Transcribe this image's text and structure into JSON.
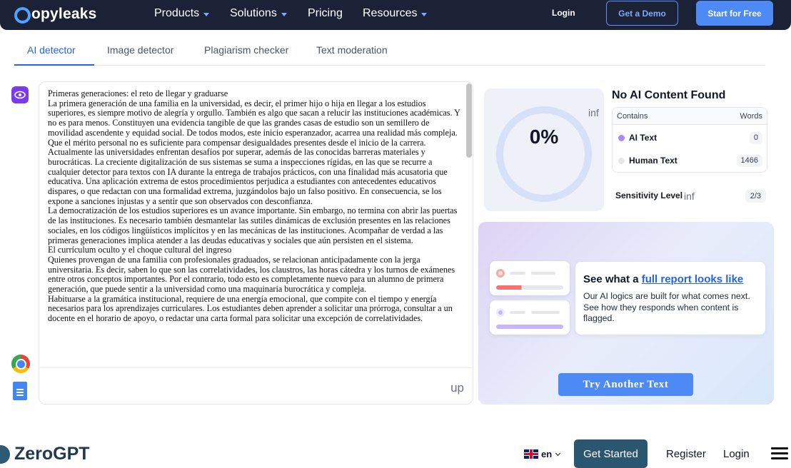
{
  "nav": {
    "brand": "Copyleaks",
    "brand_rest": "opyleaks",
    "items": [
      {
        "label": "Products",
        "has_caret": true
      },
      {
        "label": "Solutions",
        "has_caret": true
      },
      {
        "label": "Pricing",
        "has_caret": false
      },
      {
        "label": "Resources",
        "has_caret": true
      }
    ],
    "login": "Login",
    "demo": "Get a Demo",
    "free": "Start for Free",
    "accent": "#4d8af5"
  },
  "tabs": [
    {
      "label": "AI detector",
      "active": true
    },
    {
      "label": "Image detector",
      "active": false
    },
    {
      "label": "Plagiarism checker",
      "active": false
    },
    {
      "label": "Text moderation",
      "active": false
    }
  ],
  "editor": {
    "paragraphs": [
      "Primeras generaciones: el reto de llegar y graduarse",
      "La primera generación de una familia en la universidad, es decir, el primer hijo o hija en llegar a los estudios superiores, es siempre motivo de alegría y orgullo. También es algo que sacan a relucir las instituciones académicas. Y no es para menos. Constituyen una evidencia tangible de que las grandes casas de estudio son un semillero de movilidad ascendente y equidad social. De todos modos, este inicio esperanzador, acarrea una realidad más compleja. Que el mérito personal no es suficiente para compensar desigualdades presentes desde el inicio de la carrera.",
      "Actualmente las universidades enfrentan desafíos por superar, además de las conocidas barreras materiales y burocráticas. La creciente digitalización de sus sistemas se suma a inspecciones rígidas, en las que se recurre a cualquier detector para textos con IA durante la entrega de trabajos prácticos, con una finalidad más acusatoria que educativa. Una aplicación extrema de estos procedimientos perjudica a estudiantes con antecedentes educativos dispares, o que redactan con una formalidad extrema, juzgándolos bajo un falso positivo. En consecuencia, se los expone a sanciones injustas y a sentir que son observados con desconfianza.",
      "La democratización de los estudios superiores es un avance importante. Sin embargo, no termina con abrir las puertas de las instituciones. Es necesario también desmantelar las sutiles dinámicas de exclusión presentes en las relaciones sociales, en los códigos lingüísticos implícitos y en las mecánicas de las instituciones. Acompañar de verdad a las primeras generaciones implica atender a las deudas educativas y sociales que aún persisten en el sistema.",
      "El currículum oculto y el choque cultural del ingreso",
      "Quienes provengan de una familia con profesionales graduados, se relacionan anticipadamente con la jerga universitaria. Es decir, saben lo que son las correlatividades, los claustros, las horas cátedra y los turnos de exámenes entre otros conceptos importantes. Por el contrario, todo esto es completamente nuevo para un alumno de primera generación, que puede sentir a la universidad como una maquinaria burocrática y compleja.",
      "Habituarse a la gramática institucional, requiere de una energía emocional, que compite con el tiempo y energía necesarios para los aprendizajes curriculares. Los estudiantes deben aprender a solicitar una prórroga, consultar a un docente en el horario de apoyo, o redactar una carta formal para solicitar una excepción de correlatividades."
    ],
    "upload_label": "up",
    "scroll_fraction": 0.26
  },
  "result": {
    "percent_label": "0%",
    "percent": 0,
    "gauge_inf": "inf",
    "title": "No AI Content Found",
    "col_contains": "Contains",
    "col_words": "Words",
    "rows": [
      {
        "label": "AI Text",
        "count": "0",
        "color": "#a78bfa"
      },
      {
        "label": "Human Text",
        "count": "1466",
        "color": "#e5e7eb"
      }
    ],
    "sensitivity_label": "Sensitivity Level",
    "sensitivity_inf": "inf",
    "sensitivity_value": "2/3"
  },
  "promo": {
    "title_prefix": "See what a",
    "title_link": "full report looks like",
    "description": "Our AI logics are built for what comes next. See how they responds when content is flagged.",
    "try_button": "Try Another Text"
  },
  "zerogpt": {
    "brand": "ZeroGPT",
    "lang": "en",
    "get_started": "Get Started",
    "register": "Register",
    "login": "Login",
    "brand_color": "#2b566f"
  }
}
